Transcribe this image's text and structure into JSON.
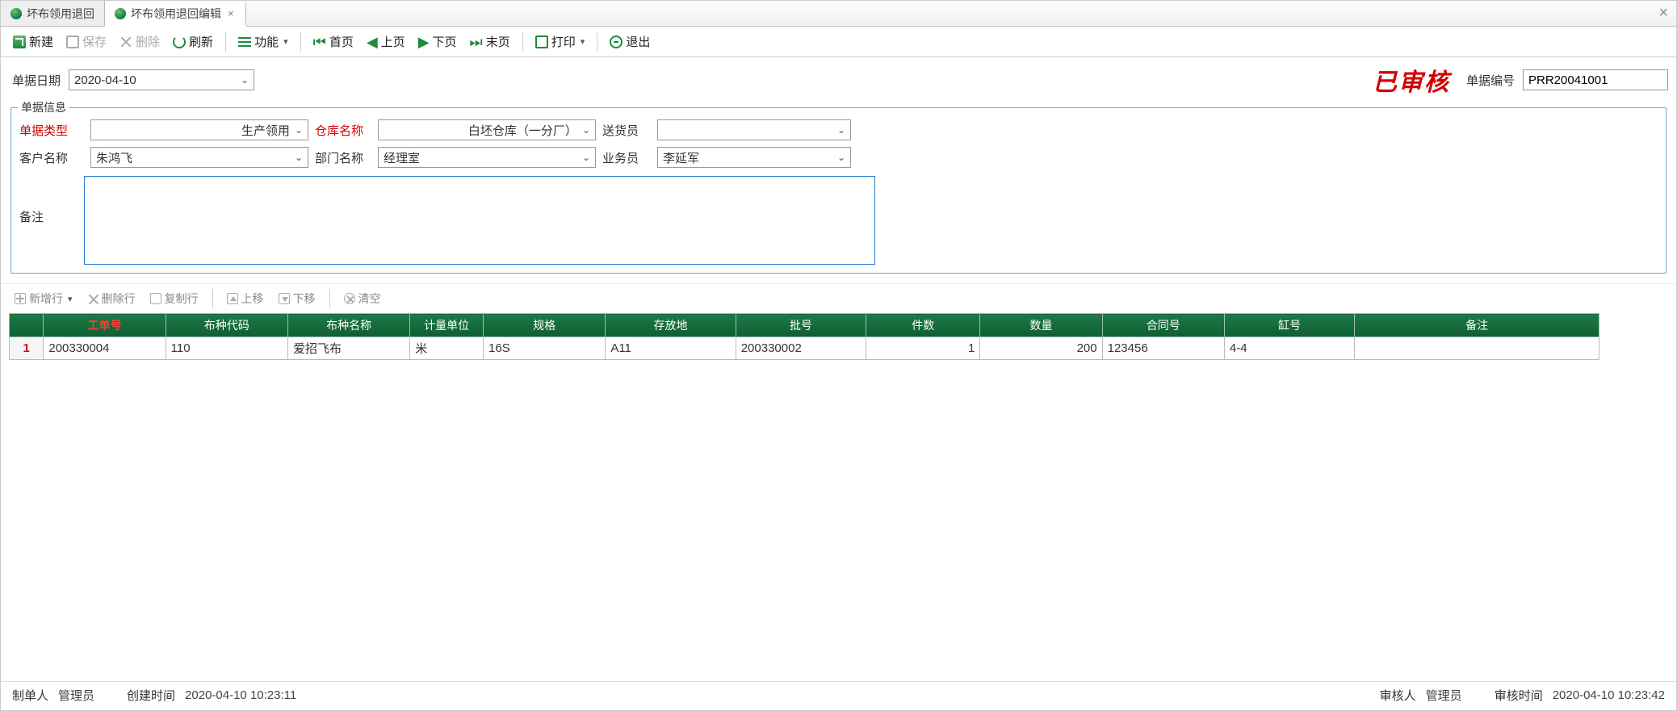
{
  "tabs": [
    {
      "label": "坏布领用退回",
      "active": false
    },
    {
      "label": "坏布领用退回编辑",
      "active": true
    }
  ],
  "toolbar": {
    "new": "新建",
    "save": "保存",
    "delete": "删除",
    "refresh": "刷新",
    "function": "功能",
    "first": "首页",
    "prev": "上页",
    "next": "下页",
    "last": "末页",
    "print": "打印",
    "exit": "退出"
  },
  "header": {
    "date_label": "单据日期",
    "date_value": "2020-04-10",
    "stamp_text": "已审核",
    "docnum_label": "单据编号",
    "docnum_value": "PRR20041001"
  },
  "fieldset": {
    "legend": "单据信息",
    "bill_type_label": "单据类型",
    "bill_type_value": "生产领用",
    "warehouse_label": "仓库名称",
    "warehouse_value": "白坯仓库（一分厂）",
    "deliverer_label": "送货员",
    "deliverer_value": "",
    "customer_label": "客户名称",
    "customer_value": "朱鸿飞",
    "dept_label": "部门名称",
    "dept_value": "经理室",
    "salesman_label": "业务员",
    "salesman_value": "李延军",
    "remark_label": "备注",
    "remark_value": ""
  },
  "grid_toolbar": {
    "add_row": "新增行",
    "del_row": "删除行",
    "copy_row": "复制行",
    "move_up": "上移",
    "move_down": "下移",
    "clear": "清空"
  },
  "grid": {
    "columns": [
      "工单号",
      "布种代码",
      "布种名称",
      "计量单位",
      "规格",
      "存放地",
      "批号",
      "件数",
      "数量",
      "合同号",
      "缸号",
      "备注"
    ],
    "rows": [
      {
        "rn": "1",
        "work_order": "200330004",
        "fabric_code": "110",
        "fabric_name": "爱招飞布",
        "unit": "米",
        "spec": "16S",
        "location": "A11",
        "batch": "200330002",
        "pieces": "1",
        "qty": "200",
        "contract": "123456",
        "vat_no": "4-4",
        "remark": ""
      }
    ]
  },
  "status": {
    "creator_label": "制单人",
    "creator_value": "管理员",
    "create_time_label": "创建时间",
    "create_time_value": "2020-04-10 10:23:11",
    "auditor_label": "审核人",
    "auditor_value": "管理员",
    "audit_time_label": "审核时间",
    "audit_time_value": "2020-04-10 10:23:42"
  }
}
